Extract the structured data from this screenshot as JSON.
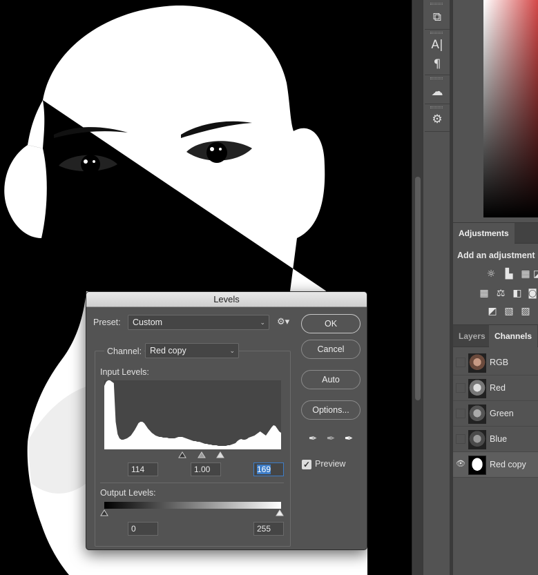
{
  "canvas": {
    "image": "high-contrast-face-mask"
  },
  "tool_strip": {
    "tools": [
      "char-panel-icon",
      "type-panel-icon",
      "paragraph-icon",
      "cc-libraries-icon",
      "properties-icon"
    ]
  },
  "adjustments": {
    "tab": "Adjustments",
    "subtitle": "Add an adjustment",
    "icons": [
      "brightness-icon",
      "levels-icon",
      "curves-icon",
      "exposure-icon",
      "vibrance-icon",
      "hue-icon",
      "balance-icon",
      "bw-icon",
      "photo-filter-icon",
      "invert-icon",
      "posterize-icon",
      "threshold-icon"
    ]
  },
  "channels_panel": {
    "tabs": [
      {
        "label": "Layers"
      },
      {
        "label": "Channels"
      }
    ],
    "rows": [
      {
        "label": "RGB",
        "visible": false
      },
      {
        "label": "Red",
        "visible": false
      },
      {
        "label": "Green",
        "visible": false
      },
      {
        "label": "Blue",
        "visible": false
      },
      {
        "label": "Red copy",
        "visible": true
      }
    ]
  },
  "levels_dialog": {
    "title": "Levels",
    "preset_label": "Preset:",
    "preset_value": "Custom",
    "channel_label": "Channel:",
    "channel_value": "Red copy",
    "input_levels_label": "Input Levels:",
    "input_black": "114",
    "input_gamma": "1.00",
    "input_white": "169",
    "output_levels_label": "Output Levels:",
    "output_black": "0",
    "output_white": "255",
    "buttons": {
      "ok": "OK",
      "cancel": "Cancel",
      "auto": "Auto",
      "options": "Options..."
    },
    "preview_label": "Preview",
    "preview_checked": true
  },
  "histogram": [
    92,
    98,
    100,
    100,
    98,
    96,
    40,
    22,
    16,
    14,
    14,
    15,
    16,
    18,
    20,
    24,
    28,
    33,
    38,
    40,
    40,
    38,
    34,
    30,
    27,
    24,
    22,
    20,
    19,
    18,
    18,
    17,
    17,
    17,
    16,
    16,
    16,
    16,
    17,
    18,
    18,
    18,
    17,
    16,
    15,
    14,
    13,
    12,
    12,
    11,
    11,
    10,
    9,
    8,
    8,
    7,
    7,
    6,
    6,
    6,
    5,
    5,
    5,
    5,
    5,
    6,
    6,
    7,
    8,
    9,
    12,
    14,
    15,
    14,
    14,
    15,
    17,
    18,
    19,
    20,
    22,
    24,
    26,
    24,
    22,
    20,
    24,
    28,
    32,
    35,
    34,
    30,
    26,
    24
  ]
}
